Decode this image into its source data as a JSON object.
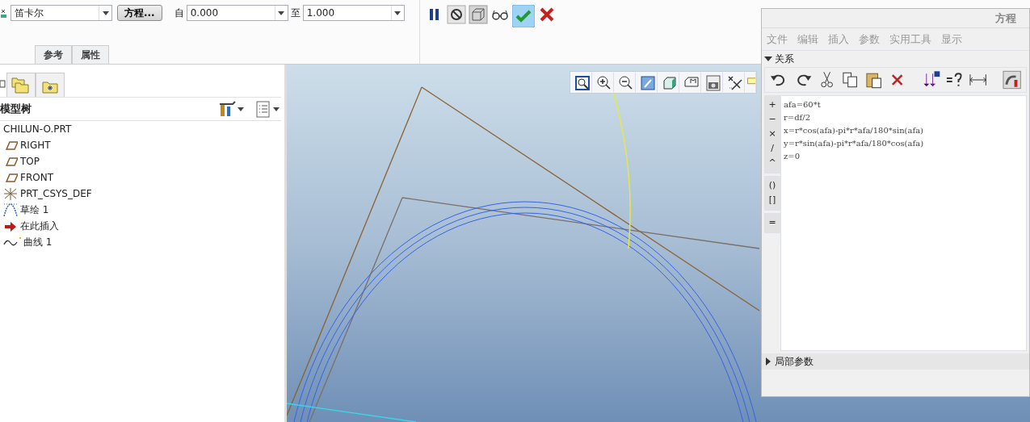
{
  "ribbon": {
    "coordinate_type": {
      "value": "笛卡尔"
    },
    "equation_button": "方程...",
    "from": {
      "label": "自",
      "value": "0.000"
    },
    "to": {
      "label": "至",
      "value": "1.000"
    },
    "tabs": [
      {
        "label": "参考",
        "selected": false
      },
      {
        "label": "属性",
        "selected": false
      }
    ]
  },
  "model_tree": {
    "title": "模型树",
    "items": [
      {
        "label": "CHILUN-O.PRT",
        "kind": "part"
      },
      {
        "label": "RIGHT",
        "kind": "plane"
      },
      {
        "label": "TOP",
        "kind": "plane"
      },
      {
        "label": "FRONT",
        "kind": "plane"
      },
      {
        "label": "PRT_CSYS_DEF",
        "kind": "csys"
      },
      {
        "label": "草绘 1",
        "kind": "sketch"
      },
      {
        "label": "在此插入",
        "kind": "insert"
      },
      {
        "label": "曲线 1",
        "kind": "curve"
      }
    ]
  },
  "equation_dialog": {
    "title": "方程",
    "menu": [
      "文件",
      "编辑",
      "插入",
      "参数",
      "实用工具",
      "显示"
    ],
    "relations": {
      "label": "关系",
      "expanded": true
    },
    "operator_groups": [
      [
        "+",
        "−",
        "×",
        "/",
        "^"
      ],
      [
        "()",
        "[]"
      ],
      [
        "="
      ]
    ],
    "lines": [
      "afa=60*t",
      "r=df/2",
      "x=r*cos(afa)-pi*r*afa/180*sin(afa)",
      "y=r*sin(afa)-pi*r*afa/180*cos(afa)",
      "z=0"
    ],
    "local_parameters": {
      "label": "局部参数",
      "expanded": false
    }
  }
}
